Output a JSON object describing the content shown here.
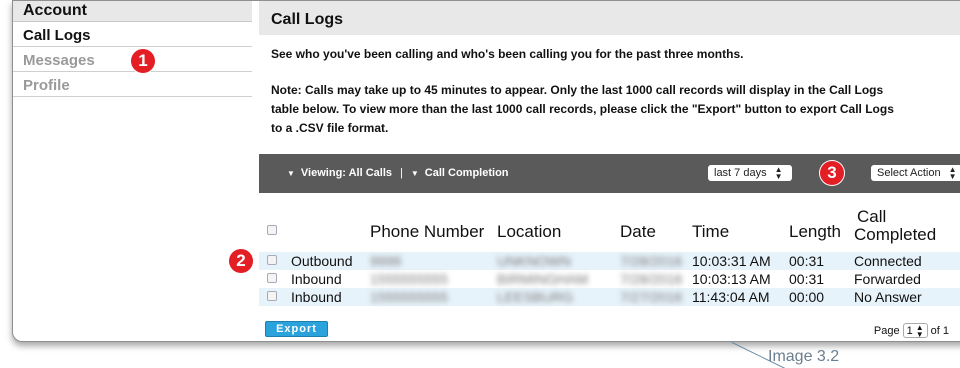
{
  "sidebar": {
    "header": "Account",
    "items": [
      {
        "label": "Call Logs",
        "active": true
      },
      {
        "label": "Messages",
        "active": false
      },
      {
        "label": "Profile",
        "active": false
      }
    ]
  },
  "main": {
    "title": "Call Logs",
    "description": "See who you've been calling and who's been calling you for the past three months.",
    "note_lines": [
      "Note: Calls may take up to 45 minutes to appear. Only the last 1000 call records will display in the Call Logs",
      "table below. To view more than the last 1000 call records, please click the \"Export\" button to export Call Logs",
      "to a .CSV file format."
    ]
  },
  "toolbar": {
    "viewing_label": "Viewing: All Calls",
    "separator": "|",
    "call_completion_label": "Call Completion",
    "range_select": "last 7 days",
    "action_select": "Select Action"
  },
  "markers": [
    "1",
    "2",
    "3"
  ],
  "table": {
    "headers": {
      "phone": "Phone Number",
      "location": "Location",
      "date": "Date",
      "time": "Time",
      "length": "Length",
      "call": "Call",
      "completed": "Completed"
    },
    "rows": [
      {
        "direction": "Outbound",
        "phone": "9999",
        "location": "UNKNOWN",
        "date": "7/28/2016",
        "time": "10:03:31 AM",
        "length": "00:31",
        "status": "Connected"
      },
      {
        "direction": "Inbound",
        "phone": "1555555555",
        "location": "BIRMINGHAM",
        "date": "7/28/2016",
        "time": "10:03:13 AM",
        "length": "00:31",
        "status": "Forwarded"
      },
      {
        "direction": "Inbound",
        "phone": "1555555555",
        "location": "LEESBURG",
        "date": "7/27/2016",
        "time": "11:43:04 AM",
        "length": "00:00",
        "status": "No Answer"
      }
    ]
  },
  "footer": {
    "export_label": "Export",
    "page_prefix": "Page",
    "page_value": "1",
    "page_suffix": "of 1"
  },
  "caption": "Image 3.2",
  "colors": {
    "marker": "#e31e24",
    "toolbar": "#5a5a5a",
    "export": "#2aa3dc",
    "row_alt": "#e7f3fb"
  }
}
